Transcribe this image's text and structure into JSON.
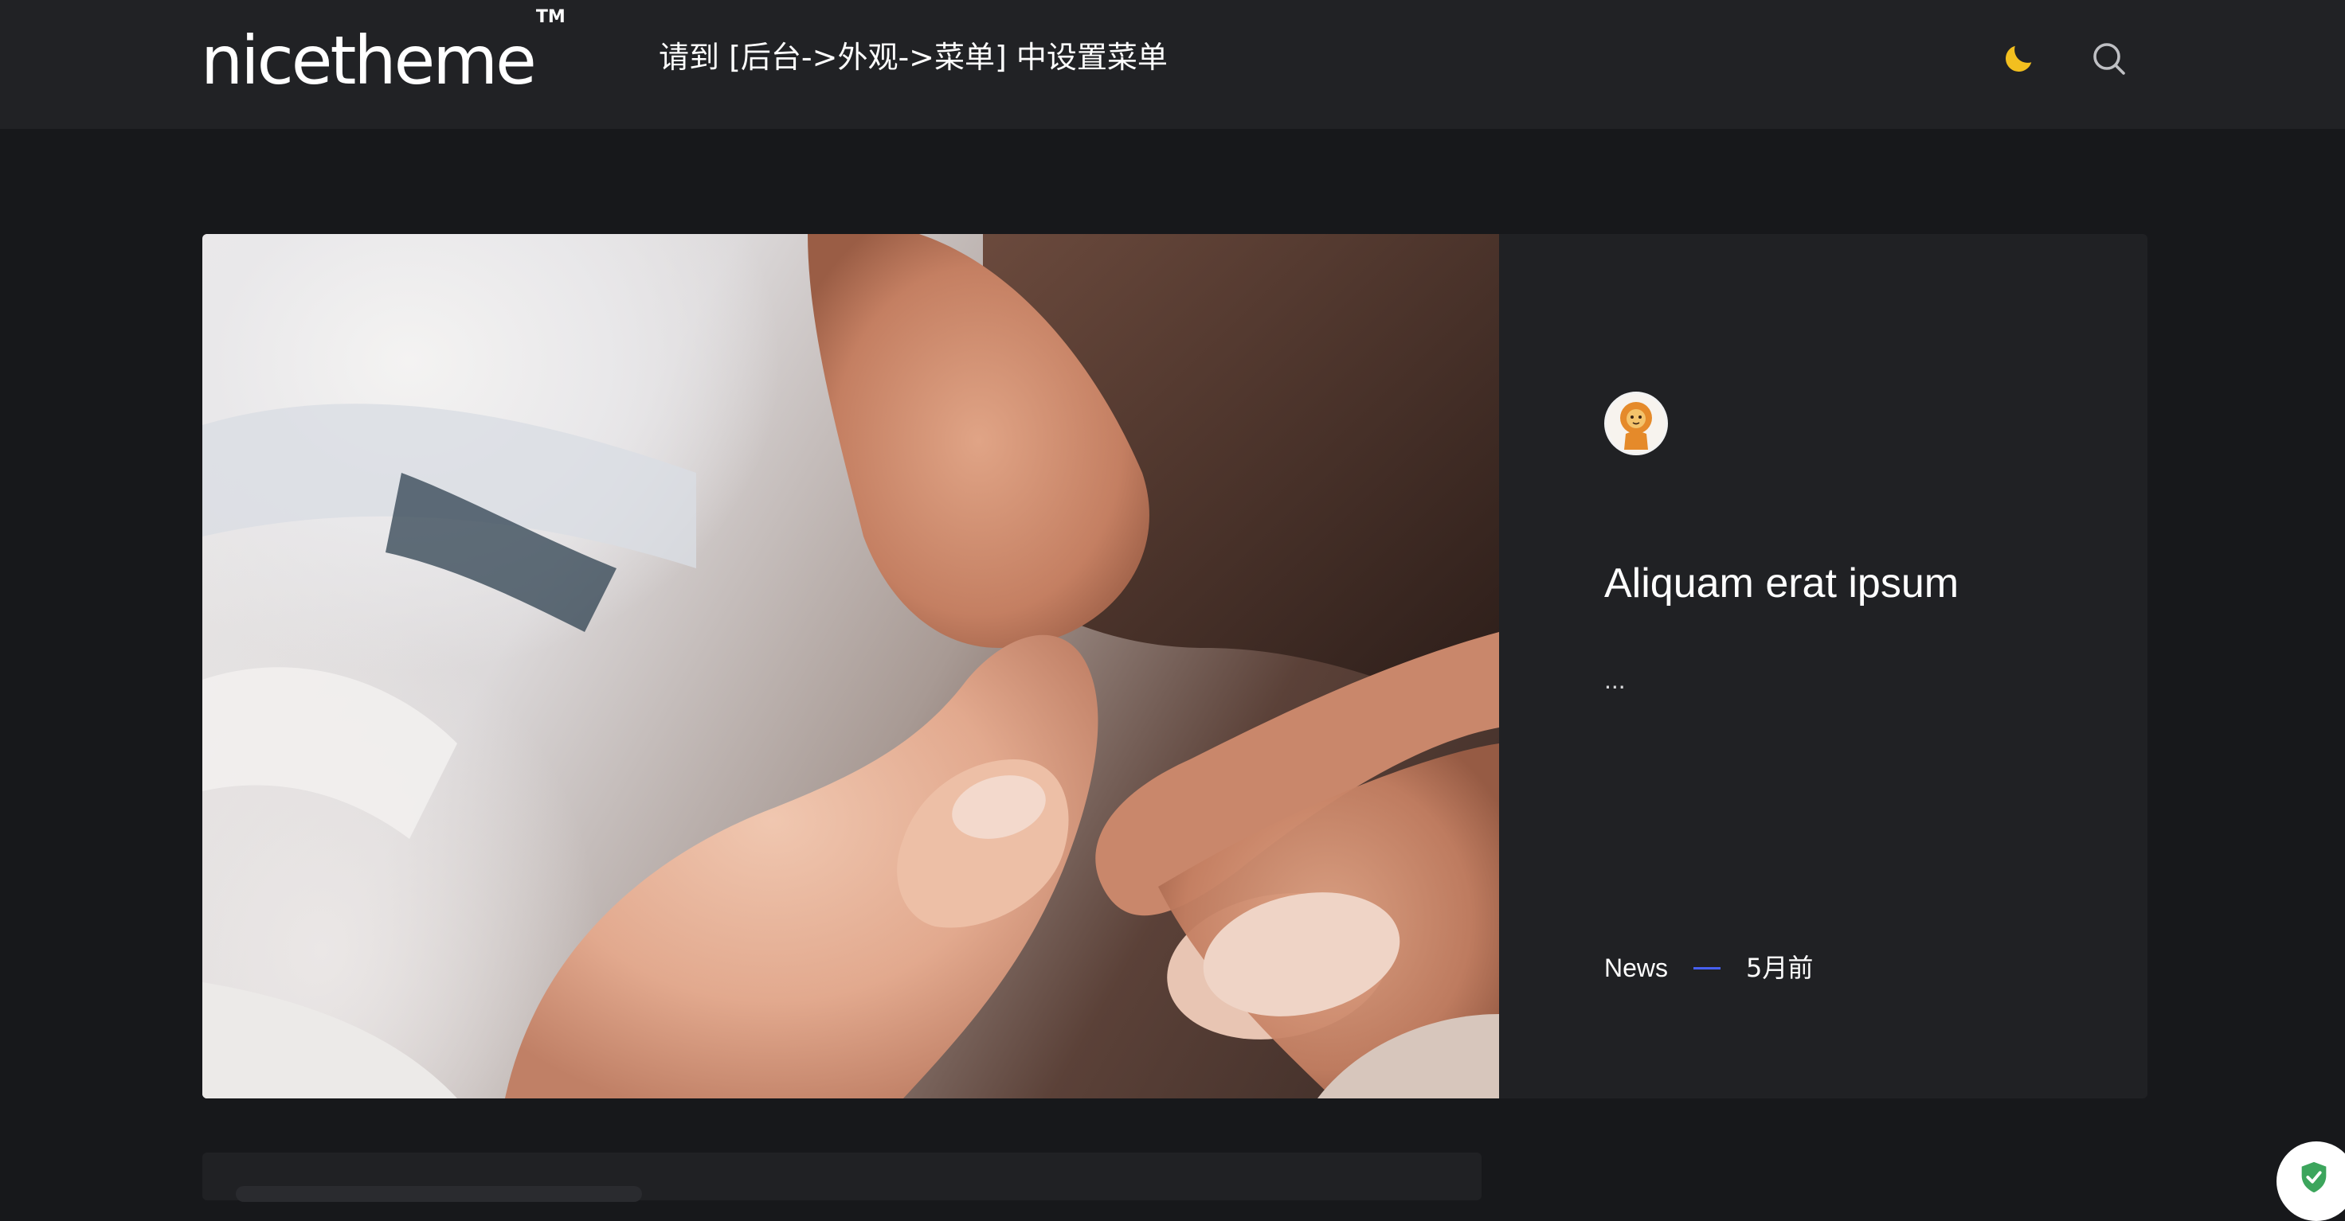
{
  "header": {
    "logo_text": "nicetheme",
    "logo_tm": "TM",
    "nav_hint": "请到 [后台->外观->菜单] 中设置菜单",
    "theme_toggle_icon": "moon-icon",
    "search_icon": "search-icon",
    "colors": {
      "background": "#212225",
      "moon": "#f2bf1f"
    }
  },
  "featured": {
    "image_alt": "",
    "title": "Aliquam erat ipsum",
    "excerpt": "...",
    "category": "News",
    "date": "5月前",
    "colors": {
      "card": "#202124",
      "dash": "#4660f0"
    }
  },
  "page": {
    "background": "#17181b"
  },
  "badge": {
    "icon": "shield-check-icon",
    "color": "#3ca55c"
  }
}
